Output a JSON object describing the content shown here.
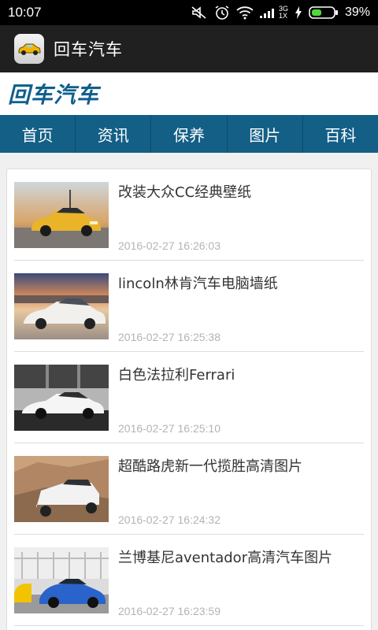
{
  "status_bar": {
    "time": "10:07",
    "network_label_top": "3G",
    "network_label_bottom": "1X",
    "battery": "39%",
    "icons": [
      "mute-icon",
      "alarm-icon",
      "wifi-icon",
      "signal-icon",
      "charging-icon",
      "battery-icon"
    ]
  },
  "app_bar": {
    "title": "回车汽车",
    "icon": "car-app-icon"
  },
  "logo": {
    "text": "回车汽车"
  },
  "nav": {
    "items": [
      {
        "label": "首页"
      },
      {
        "label": "资讯"
      },
      {
        "label": "保养"
      },
      {
        "label": "图片"
      },
      {
        "label": "百科"
      }
    ]
  },
  "articles": [
    {
      "title": "改装大众CC经典壁纸",
      "time": "2016-02-27 16:26:03"
    },
    {
      "title": "lincoln林肯汽车电脑墙纸",
      "time": "2016-02-27 16:25:38"
    },
    {
      "title": "白色法拉利Ferrari",
      "time": "2016-02-27 16:25:10"
    },
    {
      "title": "超酷路虎新一代揽胜高清图片",
      "time": "2016-02-27 16:24:32"
    },
    {
      "title": "兰博基尼aventador高清汽车图片",
      "time": "2016-02-27 16:23:59"
    }
  ],
  "colors": {
    "status_bar": "#000000",
    "app_bar": "#202020",
    "logo_text": "#0f5f8c",
    "nav_bar": "#135f86"
  }
}
